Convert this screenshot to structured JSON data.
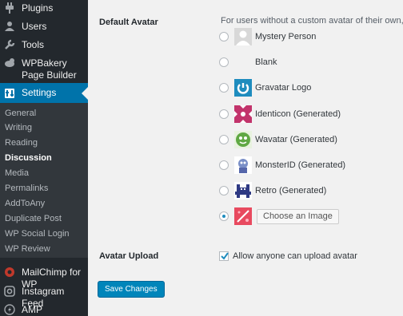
{
  "sidebar": {
    "menu": [
      {
        "label": "Plugins",
        "icon": "plugin-icon"
      },
      {
        "label": "Users",
        "icon": "users-icon"
      },
      {
        "label": "Tools",
        "icon": "wrench-icon"
      },
      {
        "label": "WPBakery Page Builder",
        "icon": "wpbakery-icon"
      },
      {
        "label": "Settings",
        "icon": "settings-icon",
        "active": true
      }
    ],
    "submenu": [
      "General",
      "Writing",
      "Reading",
      "Discussion",
      "Media",
      "Permalinks",
      "AddToAny",
      "Duplicate Post",
      "WP Social Login",
      "WP Review"
    ],
    "current_submenu": "Discussion",
    "bottom_menu": [
      {
        "label": "MailChimp for WP",
        "icon": "mailchimp-icon"
      },
      {
        "label": "Instagram Feed",
        "icon": "instagram-icon"
      },
      {
        "label": "AMP",
        "icon": "amp-icon"
      }
    ]
  },
  "main": {
    "default_avatar_label": "Default Avatar",
    "description": "For users without a custom avatar of their own, you ca",
    "options": [
      {
        "label": "Mystery Person",
        "icon": "mystery-person-avatar"
      },
      {
        "label": "Blank",
        "icon": "blank-avatar"
      },
      {
        "label": "Gravatar Logo",
        "icon": "gravatar-logo-avatar"
      },
      {
        "label": "Identicon (Generated)",
        "icon": "identicon-avatar"
      },
      {
        "label": "Wavatar (Generated)",
        "icon": "wavatar-avatar"
      },
      {
        "label": "MonsterID (Generated)",
        "icon": "monsterid-avatar"
      },
      {
        "label": "Retro (Generated)",
        "icon": "retro-avatar"
      }
    ],
    "custom_option": {
      "button_label": "Choose an Image",
      "selected": true,
      "icon": "custom-image-avatar"
    },
    "avatar_upload_label": "Avatar Upload",
    "allow_upload_label": "Allow anyone can upload avatar",
    "allow_upload_checked": true,
    "save_button": "Save Changes",
    "annotation_arrow_color": "#f0456e"
  },
  "colors": {
    "sidebar_bg": "#23282d",
    "submenu_bg": "#32373c",
    "accent": "#0073aa",
    "button": "#0085ba",
    "arrow": "#f0456e"
  }
}
